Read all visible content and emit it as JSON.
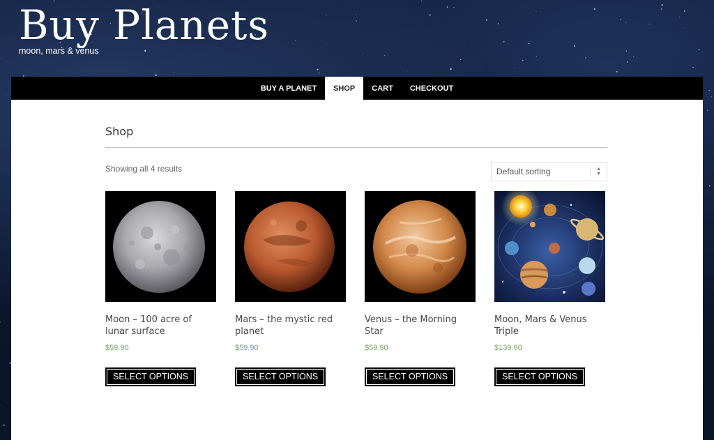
{
  "site": {
    "title": "Buy Planets",
    "tagline": "moon, mars & venus"
  },
  "nav": {
    "items": [
      {
        "label": "BUY A PLANET",
        "active": false
      },
      {
        "label": "SHOP",
        "active": true
      },
      {
        "label": "CART",
        "active": false
      },
      {
        "label": "CHECKOUT",
        "active": false
      }
    ]
  },
  "page": {
    "title": "Shop",
    "result_count": "Showing all 4 results",
    "sort": {
      "selected": "Default sorting"
    }
  },
  "products": [
    {
      "name": "Moon – 100 acre of lunar surface",
      "price": "$59.90",
      "button": "SELECT OPTIONS",
      "image": "moon-image"
    },
    {
      "name": "Mars – the mystic red planet",
      "price": "$59.90",
      "button": "SELECT OPTIONS",
      "image": "mars-image"
    },
    {
      "name": "Venus – the Morning Star",
      "price": "$59.90",
      "button": "SELECT OPTIONS",
      "image": "venus-image"
    },
    {
      "name": "Moon, Mars & Venus Triple",
      "price": "$139.90",
      "button": "SELECT OPTIONS",
      "image": "solar-system-image"
    }
  ],
  "colors": {
    "price": "#77a464",
    "nav_bg": "#000000",
    "button_bg": "#000000"
  }
}
